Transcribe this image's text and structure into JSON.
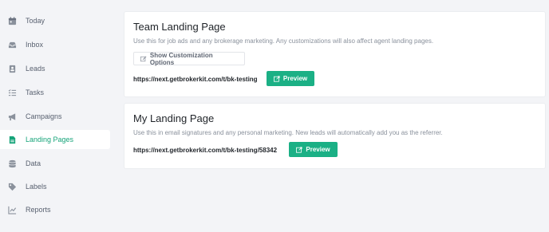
{
  "sidebar": {
    "items": [
      {
        "label": "Today",
        "icon": "calendar-icon"
      },
      {
        "label": "Inbox",
        "icon": "inbox-icon"
      },
      {
        "label": "Leads",
        "icon": "contact-card-icon"
      },
      {
        "label": "Tasks",
        "icon": "task-list-icon"
      },
      {
        "label": "Campaigns",
        "icon": "megaphone-icon"
      },
      {
        "label": "Landing Pages",
        "icon": "document-icon",
        "active": true
      },
      {
        "label": "Data",
        "icon": "database-icon"
      },
      {
        "label": "Labels",
        "icon": "tags-icon"
      },
      {
        "label": "Reports",
        "icon": "line-chart-icon"
      }
    ]
  },
  "team_card": {
    "title": "Team Landing Page",
    "description": "Use this for job ads and any brokerage marketing. Any customizations will also affect agent landing pages.",
    "customize_label": "Show Customization Options",
    "url": "https://next.getbrokerkit.com/t/bk-testing",
    "preview_label": "Preview"
  },
  "my_card": {
    "title": "My Landing Page",
    "description": "Use this in email signatures and any personal marketing. New leads will automatically add you as the referrer.",
    "url": "https://next.getbrokerkit.com/t/bk-testing/58342",
    "preview_label": "Preview"
  },
  "colors": {
    "accent": "#1bb085",
    "active_text": "#17a47a",
    "sidebar_text": "#596170",
    "background": "#f3f4f7"
  }
}
